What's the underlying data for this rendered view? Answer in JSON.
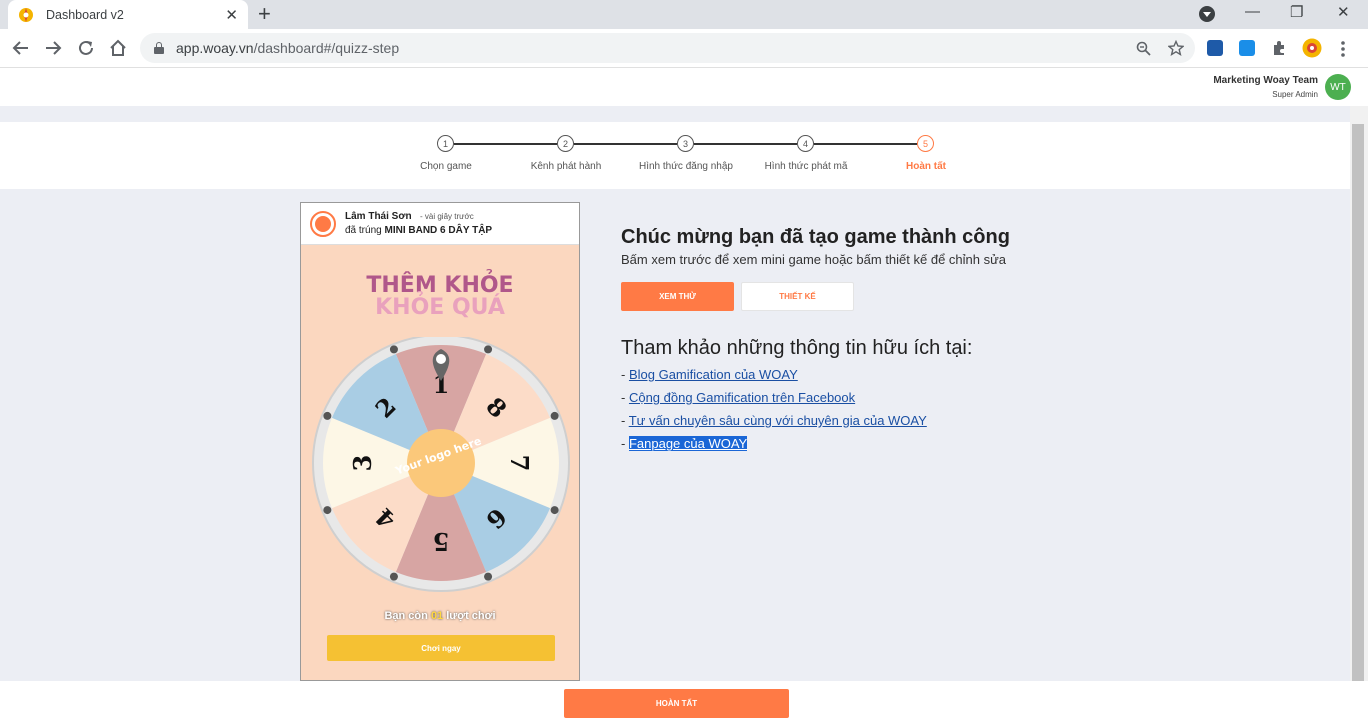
{
  "browser": {
    "tab_title": "Dashboard v2",
    "tab_close": "✕",
    "new_tab": "+",
    "url_host": "app.woay.vn",
    "url_path": "/dashboard#/quizz-step",
    "min": "—",
    "restore": "❐",
    "close": "✕"
  },
  "header": {
    "user_name": "Marketing Woay Team",
    "user_role": "Super Admin",
    "avatar_initials": "WT"
  },
  "stepper": {
    "steps": [
      {
        "number": "1",
        "label": "Chọn game"
      },
      {
        "number": "2",
        "label": "Kênh phát hành"
      },
      {
        "number": "3",
        "label": "Hình thức đăng nhập"
      },
      {
        "number": "4",
        "label": "Hình thức phát mã"
      },
      {
        "number": "5",
        "label": "Hoàn tất"
      }
    ],
    "active_step": 5,
    "accent_color": "#ff7a45"
  },
  "preview": {
    "notification": {
      "name": "Lâm Thái Sơn",
      "time": "- vài giây trước",
      "action": "đã trúng",
      "prize": "MINI BAND 6 DÂY TẬP"
    },
    "title_line1": "THÊM KHỎE",
    "title_line2": "KHỎE QUÁ",
    "wheel_numbers": [
      "1",
      "8",
      "7",
      "6",
      "5",
      "4",
      "3",
      "2"
    ],
    "wheel_center": "Your logo here",
    "remaining_prefix": "Bạn còn",
    "remaining_count": "01",
    "remaining_suffix": "lượt chơi",
    "play_button": "Chơi ngay"
  },
  "success": {
    "title": "Chúc mừng bạn đã tạo game thành công",
    "subtitle": "Bấm xem trước để xem mini game hoặc bấm thiết kế để chỉnh sửa",
    "preview_button": "XEM THỬ",
    "design_button": "THIẾT KẾ"
  },
  "references": {
    "title": "Tham khảo những thông tin hữu ích tại:",
    "links": [
      {
        "prefix": "- ",
        "text": "Blog Gamification của WOAY"
      },
      {
        "prefix": "- ",
        "text": "Cộng đồng Gamification trên Facebook"
      },
      {
        "prefix": "- ",
        "text": "Tư vấn chuyên sâu cùng với chuyên gia của WOAY"
      },
      {
        "prefix": "- ",
        "text": "Fanpage của WOAY"
      }
    ]
  },
  "footer": {
    "finish_button": "HOÀN TẤT"
  }
}
